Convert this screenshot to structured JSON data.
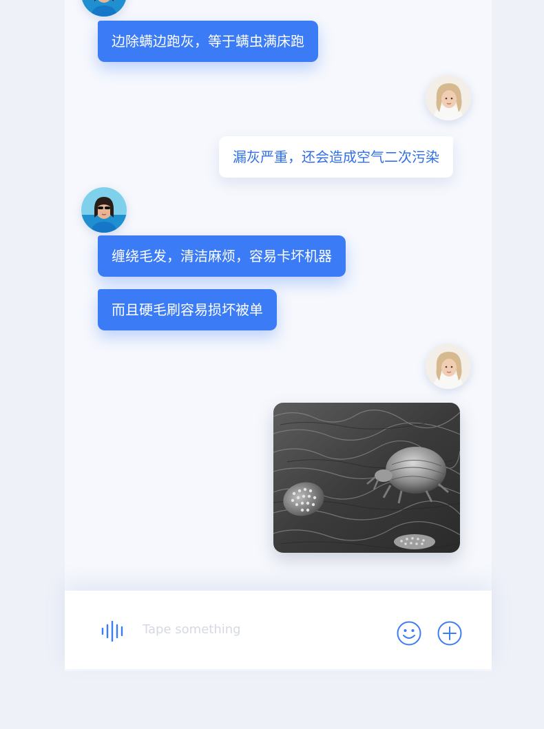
{
  "chat": {
    "messages": [
      {
        "sender": "friend",
        "text": "边除螨边跑灰，等于螨虫满床跑"
      },
      {
        "sender": "me",
        "text": "漏灰严重，还会造成空气二次污染"
      },
      {
        "sender": "friend",
        "text": "缠绕毛发，清洁麻烦，容易卡坏机器"
      },
      {
        "sender": "friend",
        "text": "而且硬毛刷容易损坏被单"
      },
      {
        "sender": "me",
        "type": "image",
        "image": "dust-mite-micrograph"
      }
    ]
  },
  "input": {
    "placeholder": "Tape something",
    "voice_icon": "voice-wave-icon",
    "emoji_icon": "emoji-icon",
    "add_icon": "plus-icon"
  },
  "colors": {
    "accent": "#3b7bf6",
    "background": "#f6f8fd",
    "outgoing_text": "#2f6fe8"
  }
}
